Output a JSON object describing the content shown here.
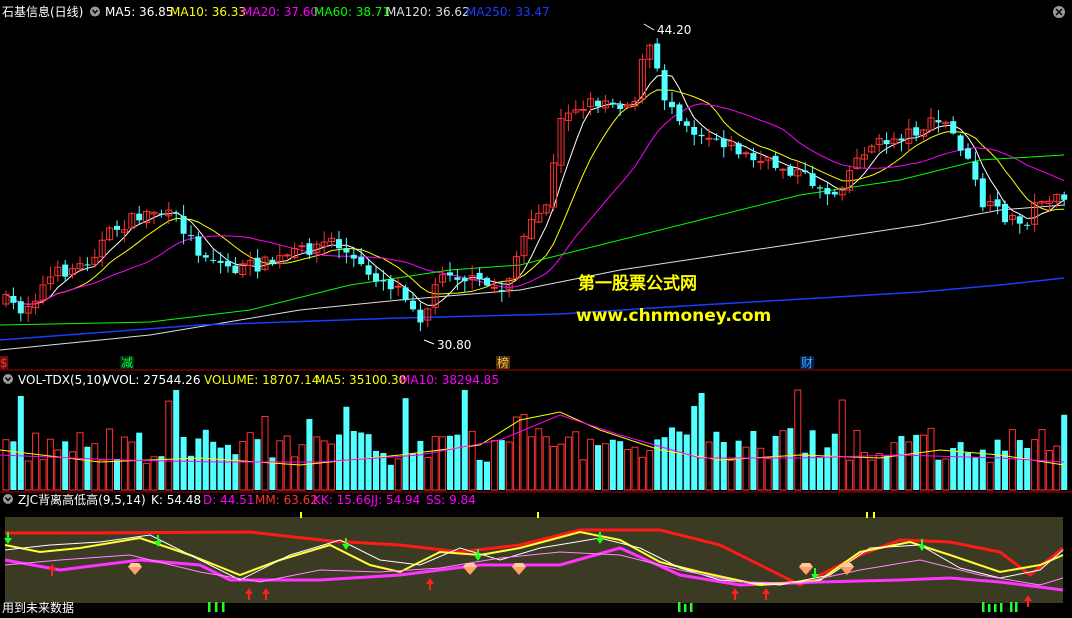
{
  "main_panel": {
    "title": "石基信息(日线)",
    "ma": [
      {
        "label": "MA5: 36.85",
        "color": "#ffffff"
      },
      {
        "label": "MA10: 36.33",
        "color": "#ffff00"
      },
      {
        "label": "MA20: 37.60",
        "color": "#ff00ff"
      },
      {
        "label": "MA60: 38.71",
        "color": "#00ff00"
      },
      {
        "label": "MA120: 36.62",
        "color": "#dddddd"
      },
      {
        "label": "MA250: 33.47",
        "color": "#1a3cff"
      }
    ],
    "high_label": "44.20",
    "low_label": "30.80",
    "markers": [
      {
        "text": "$",
        "color": "#ff3030",
        "bg": "#661010"
      },
      {
        "text": "减",
        "color": "#00ff40",
        "bg": "#003010"
      },
      {
        "text": "榜",
        "color": "#ffc040",
        "bg": "#503010"
      },
      {
        "text": "财",
        "color": "#40b0ff",
        "bg": "#002050"
      }
    ],
    "watermark": {
      "line1": "第一股票公式网",
      "line2": "www.chnmoney.com"
    }
  },
  "volume_panel": {
    "title": "VOL-TDX(5,10)",
    "labels": [
      {
        "text": "VVOL: 27544.26",
        "color": "#ffffff"
      },
      {
        "text": "VOLUME: 18707.14",
        "color": "#ffff00"
      },
      {
        "text": "MA5: 35100.30",
        "color": "#ffff00"
      },
      {
        "text": "MA10: 38294.85",
        "color": "#ff00ff"
      }
    ]
  },
  "indicator_panel": {
    "title": "ZJC背离高低高(9,5,14)",
    "labels": [
      {
        "text": "K: 54.48",
        "color": "#ffffff"
      },
      {
        "text": "D: 44.51",
        "color": "#ff00ff"
      },
      {
        "text": "MM: 63.62",
        "color": "#ff3030"
      },
      {
        "text": "KK: 15.66",
        "color": "#ff00ff"
      },
      {
        "text": "JJ: 54.94",
        "color": "#ff00ff"
      },
      {
        "text": "SS: 9.84",
        "color": "#ff00ff"
      }
    ],
    "footer": "用到未来数据"
  },
  "colors": {
    "up": "#ff3232",
    "down": "#54ffff",
    "grid": "#b00000",
    "indicator_bg": "#3b3a22"
  }
}
